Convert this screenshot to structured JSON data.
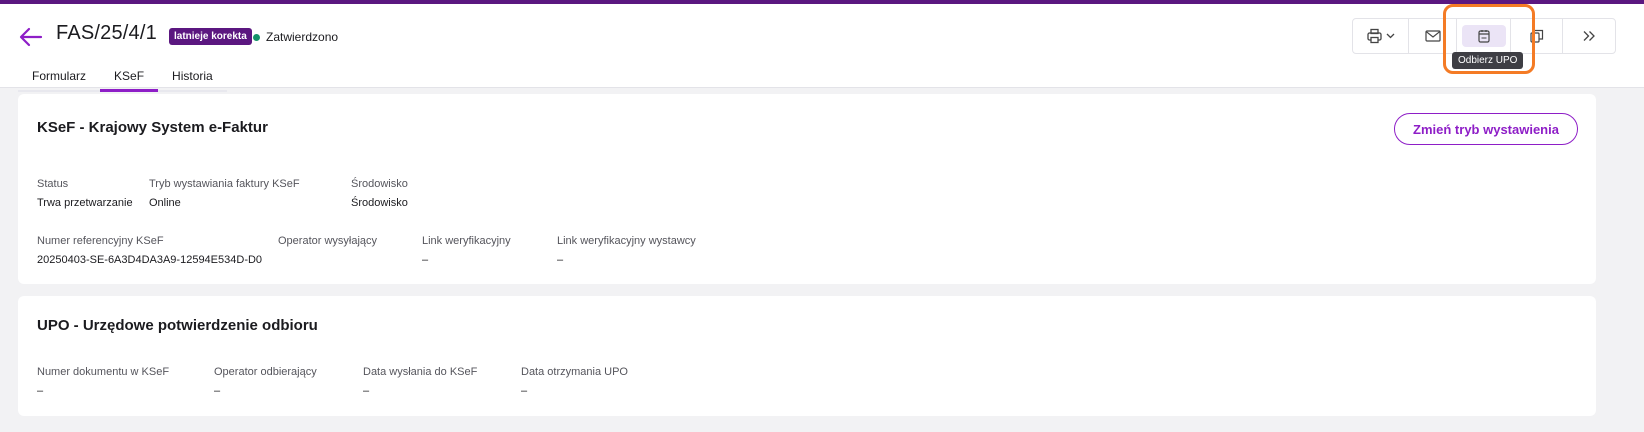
{
  "header": {
    "doc_number": "FAS/25/4/1",
    "badge": "latnieje korekta",
    "status": "Zatwierdzono",
    "status_color": "#139268",
    "accent_color": "#8e1ec7",
    "back_icon": "arrow-left-icon"
  },
  "tabs": [
    {
      "label": "Formularz",
      "active": false
    },
    {
      "label": "KSeF",
      "active": true
    },
    {
      "label": "Historia",
      "active": false
    }
  ],
  "toolbar": {
    "buttons": [
      {
        "name": "print",
        "icon": "printer-icon"
      },
      {
        "name": "mail",
        "icon": "mail-icon"
      },
      {
        "name": "upo",
        "icon": "upo-download-icon"
      },
      {
        "name": "copy",
        "icon": "copy-icon"
      },
      {
        "name": "more",
        "icon": "chevrons-right-icon"
      }
    ],
    "tooltip": "Odbierz UPO"
  },
  "ksef_card": {
    "title": "KSeF - Krajowy System e-Faktur",
    "change_button": "Zmień tryb wystawienia",
    "fields_row1": [
      {
        "label": "Status",
        "value": "Trwa przetwarzanie"
      },
      {
        "label": "Tryb wystawiania faktury KSeF",
        "value": "Online"
      },
      {
        "label": "Środowisko",
        "value": "Środowisko"
      }
    ],
    "fields_row2": [
      {
        "label": "Numer referencyjny KSeF",
        "value": "20250403-SE-6A3D4DA3A9-12594E534D-D0"
      },
      {
        "label": "Operator wysyłający",
        "value": ""
      },
      {
        "label": "Link weryfikacyjny",
        "value": "–"
      },
      {
        "label": "Link weryfikacyjny wystawcy",
        "value": "–"
      }
    ]
  },
  "upo_card": {
    "title": "UPO - Urzędowe potwierdzenie odbioru",
    "fields": [
      {
        "label": "Numer dokumentu w KSeF",
        "value": "–"
      },
      {
        "label": "Operator odbierający",
        "value": "–"
      },
      {
        "label": "Data wysłania do KSeF",
        "value": "–"
      },
      {
        "label": "Data otrzymania UPO",
        "value": "–"
      }
    ]
  }
}
